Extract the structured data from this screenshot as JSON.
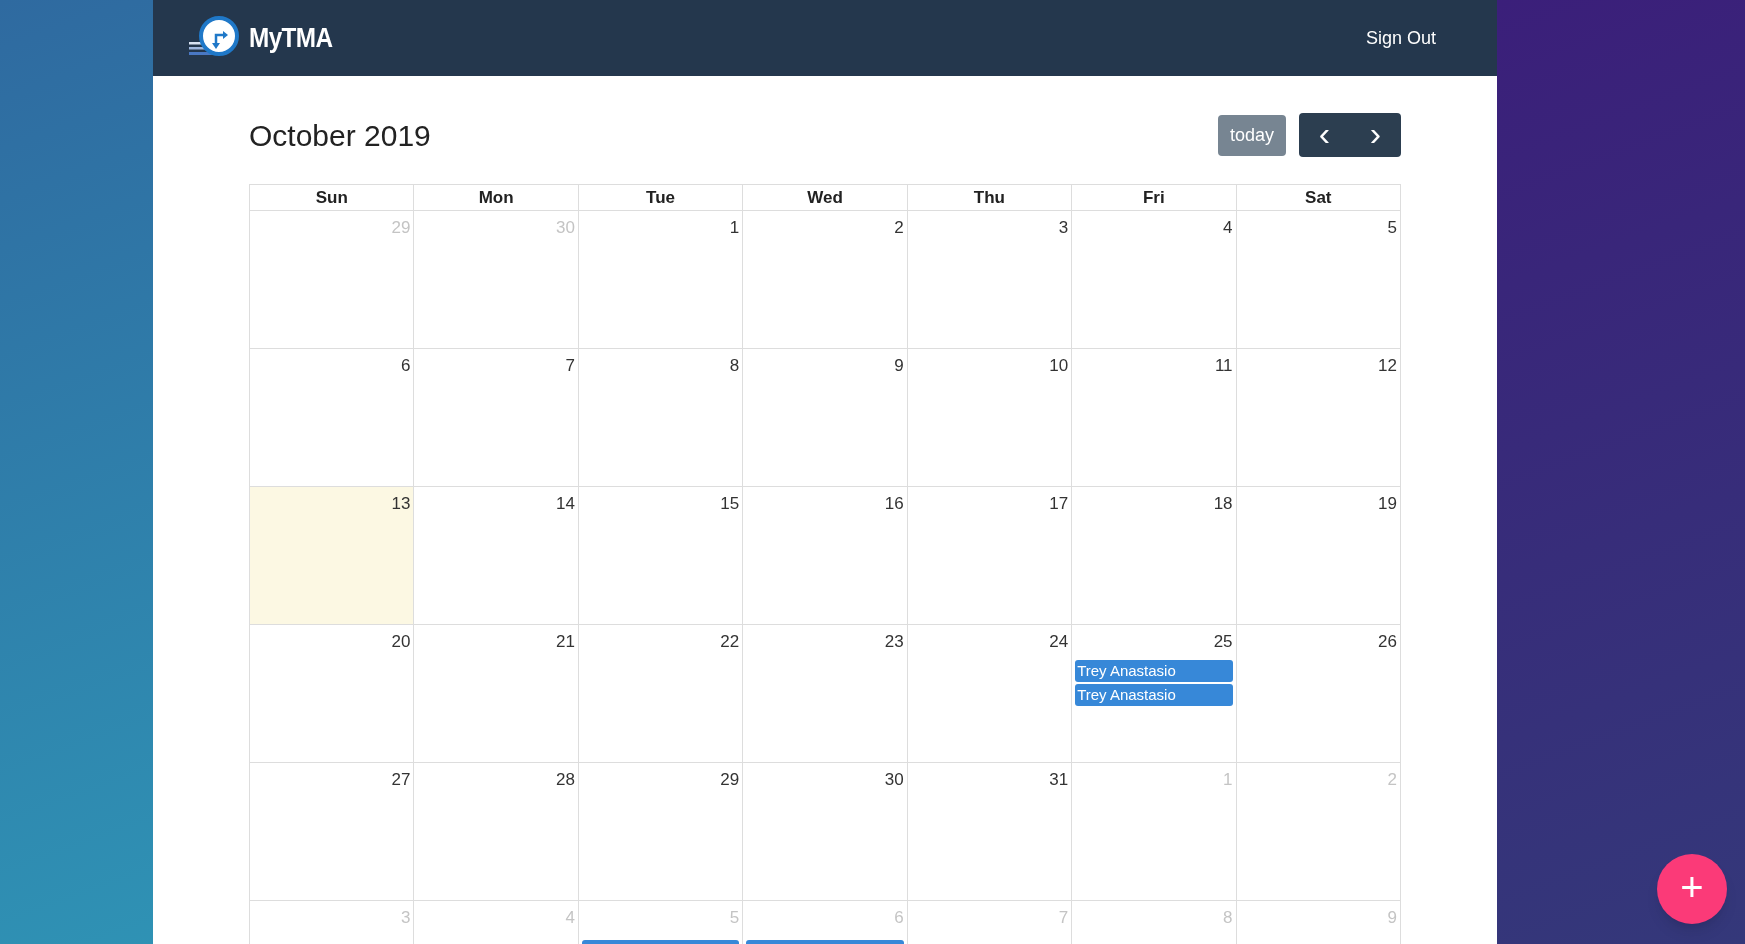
{
  "header": {
    "brand": "MyTMA",
    "sign_out": "Sign Out"
  },
  "calendar": {
    "title": "October 2019",
    "today_button": "today",
    "prev_icon": "‹",
    "next_icon": "›",
    "weekdays": [
      "Sun",
      "Mon",
      "Tue",
      "Wed",
      "Thu",
      "Fri",
      "Sat"
    ],
    "weeks": [
      [
        {
          "day": "29",
          "other_month": true,
          "today": false
        },
        {
          "day": "30",
          "other_month": true,
          "today": false
        },
        {
          "day": "1",
          "other_month": false,
          "today": false
        },
        {
          "day": "2",
          "other_month": false,
          "today": false
        },
        {
          "day": "3",
          "other_month": false,
          "today": false
        },
        {
          "day": "4",
          "other_month": false,
          "today": false
        },
        {
          "day": "5",
          "other_month": false,
          "today": false
        }
      ],
      [
        {
          "day": "6",
          "other_month": false,
          "today": false
        },
        {
          "day": "7",
          "other_month": false,
          "today": false
        },
        {
          "day": "8",
          "other_month": false,
          "today": false
        },
        {
          "day": "9",
          "other_month": false,
          "today": false
        },
        {
          "day": "10",
          "other_month": false,
          "today": false
        },
        {
          "day": "11",
          "other_month": false,
          "today": false
        },
        {
          "day": "12",
          "other_month": false,
          "today": false
        }
      ],
      [
        {
          "day": "13",
          "other_month": false,
          "today": true
        },
        {
          "day": "14",
          "other_month": false,
          "today": false
        },
        {
          "day": "15",
          "other_month": false,
          "today": false
        },
        {
          "day": "16",
          "other_month": false,
          "today": false
        },
        {
          "day": "17",
          "other_month": false,
          "today": false
        },
        {
          "day": "18",
          "other_month": false,
          "today": false
        },
        {
          "day": "19",
          "other_month": false,
          "today": false
        }
      ],
      [
        {
          "day": "20",
          "other_month": false,
          "today": false
        },
        {
          "day": "21",
          "other_month": false,
          "today": false
        },
        {
          "day": "22",
          "other_month": false,
          "today": false
        },
        {
          "day": "23",
          "other_month": false,
          "today": false
        },
        {
          "day": "24",
          "other_month": false,
          "today": false
        },
        {
          "day": "25",
          "other_month": false,
          "today": false,
          "events": [
            {
              "kind": "event",
              "title": "Trey Anastasio"
            },
            {
              "kind": "event",
              "title": "Trey Anastasio"
            }
          ]
        },
        {
          "day": "26",
          "other_month": false,
          "today": false
        }
      ],
      [
        {
          "day": "27",
          "other_month": false,
          "today": false
        },
        {
          "day": "28",
          "other_month": false,
          "today": false
        },
        {
          "day": "29",
          "other_month": false,
          "today": false
        },
        {
          "day": "30",
          "other_month": false,
          "today": false
        },
        {
          "day": "31",
          "other_month": false,
          "today": false
        },
        {
          "day": "1",
          "other_month": true,
          "today": false
        },
        {
          "day": "2",
          "other_month": true,
          "today": false
        }
      ],
      [
        {
          "day": "3",
          "other_month": true,
          "today": false
        },
        {
          "day": "4",
          "other_month": true,
          "today": false
        },
        {
          "day": "5",
          "other_month": true,
          "today": false,
          "events": [
            {
              "kind": "clipped"
            }
          ]
        },
        {
          "day": "6",
          "other_month": true,
          "today": false,
          "events": [
            {
              "kind": "clipped"
            }
          ]
        },
        {
          "day": "7",
          "other_month": true,
          "today": false
        },
        {
          "day": "8",
          "other_month": true,
          "today": false
        },
        {
          "day": "9",
          "other_month": true,
          "today": false
        }
      ]
    ]
  },
  "fab": {
    "label": "+"
  }
}
